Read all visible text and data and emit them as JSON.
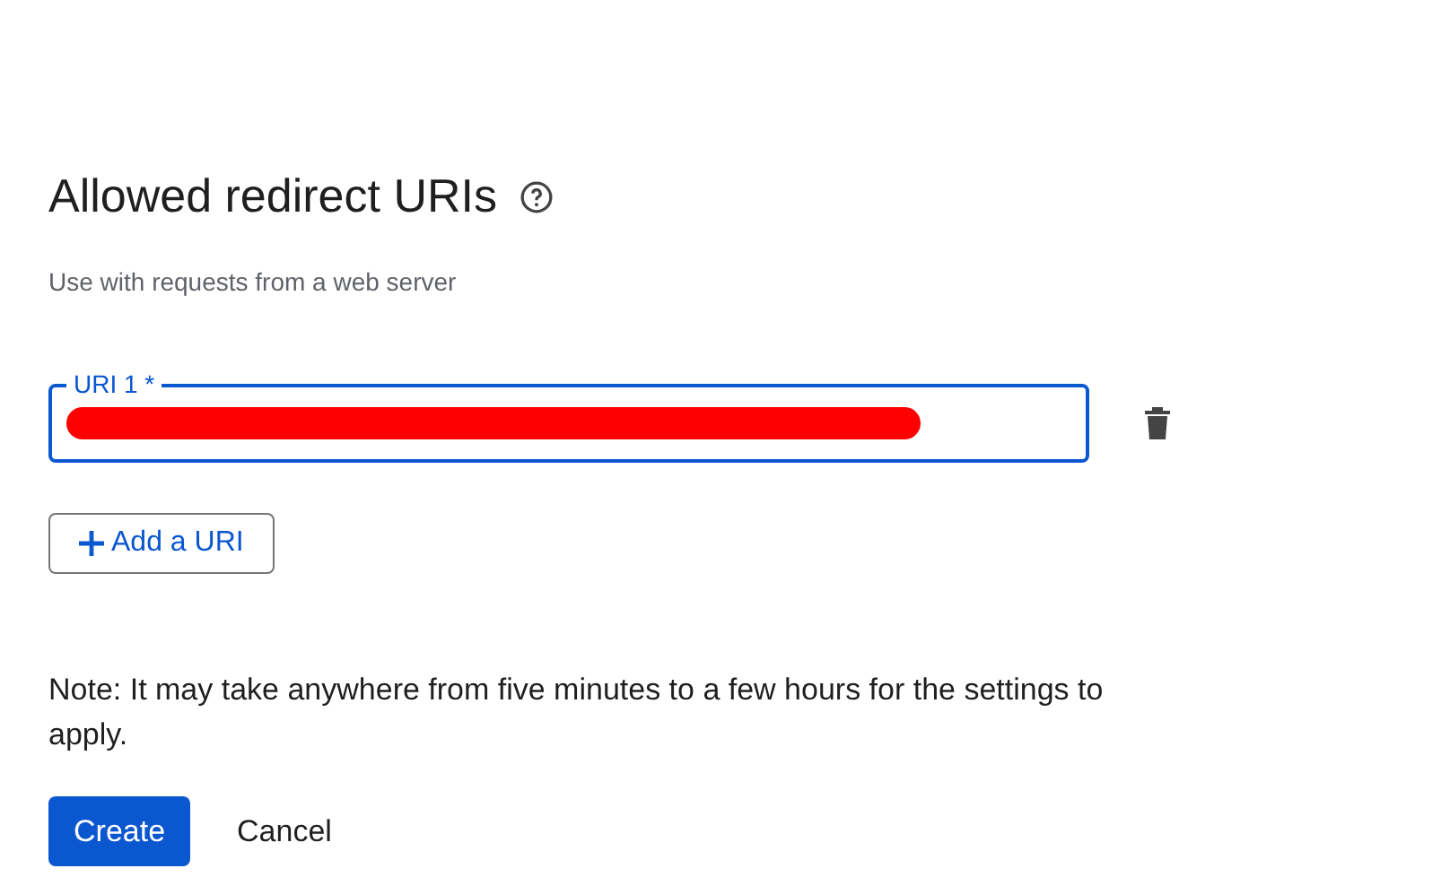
{
  "section": {
    "title": "Allowed redirect URIs",
    "subtitle": "Use with requests from a web server"
  },
  "uris": [
    {
      "label": "URI 1 *",
      "focused": true,
      "redacted": true
    }
  ],
  "add_button": "Add a URI",
  "note": "Note: It may take anywhere from five minutes to a few hours for the settings to apply.",
  "buttons": [
    {
      "label": "Create",
      "kind": "primary"
    },
    {
      "label": "Cancel",
      "kind": "text"
    }
  ]
}
